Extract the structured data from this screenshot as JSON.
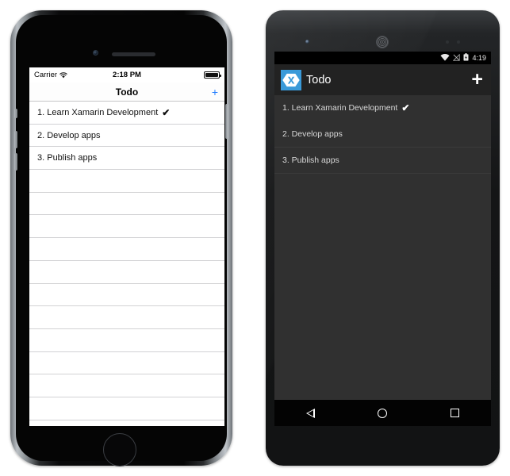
{
  "ios": {
    "status_bar": {
      "carrier": "Carrier",
      "wifi_icon": "wifi-icon",
      "time": "2:18 PM",
      "battery_icon": "battery-full-icon"
    },
    "nav_bar": {
      "title": "Todo",
      "add_label": "+"
    },
    "list": {
      "items": [
        {
          "text": "1. Learn Xamarin Development",
          "done": true,
          "check": "✔"
        },
        {
          "text": "2. Develop apps",
          "done": false,
          "check": ""
        },
        {
          "text": "3. Publish apps",
          "done": false,
          "check": ""
        }
      ],
      "empty_row_count": 12
    }
  },
  "android": {
    "status_bar": {
      "wifi_icon": "wifi-icon",
      "signal_icon": "no-signal-icon",
      "battery_icon": "battery-charging-icon",
      "time": "4:19"
    },
    "app_bar": {
      "logo": "xamarin-logo",
      "logo_letter": "X",
      "title": "Todo",
      "add_label": "+"
    },
    "list": {
      "items": [
        {
          "text": "1. Learn Xamarin Development",
          "done": true,
          "check": "✔"
        },
        {
          "text": "2. Develop apps",
          "done": false,
          "check": ""
        },
        {
          "text": "3. Publish apps",
          "done": false,
          "check": ""
        }
      ]
    },
    "nav_bar": {
      "back": "back-icon",
      "home": "home-icon",
      "recents": "recents-icon"
    }
  },
  "colors": {
    "ios_accent": "#1f7cff",
    "xamarin_blue": "#3a9ad9",
    "android_appbar": "#222222",
    "android_content": "#303030"
  }
}
